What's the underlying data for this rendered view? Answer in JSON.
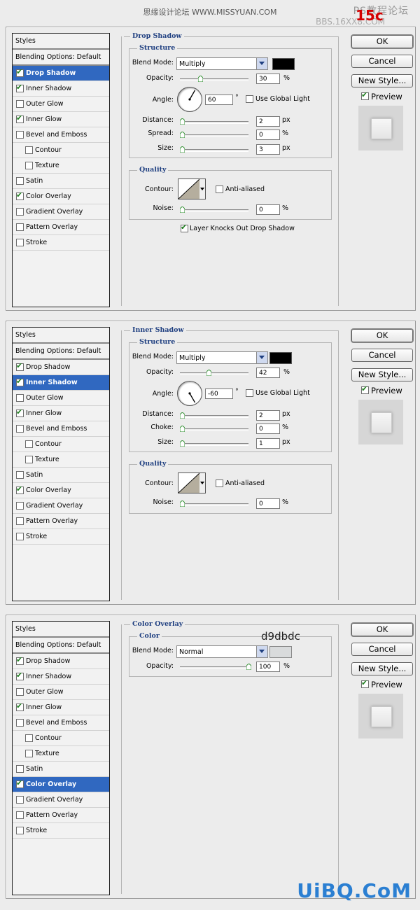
{
  "header": {
    "site_title": "思缘设计论坛 WWW.MISSYUAN.COM",
    "watermark_tr": "PS教程论坛",
    "watermark_tr2": "BBS.16XX8.COM",
    "watermark_num": "15c"
  },
  "styles_list": {
    "header": "Styles",
    "blending_options": "Blending Options: Default",
    "items": [
      "Drop Shadow",
      "Inner Shadow",
      "Outer Glow",
      "Inner Glow",
      "Bevel and Emboss",
      "Contour",
      "Texture",
      "Satin",
      "Color Overlay",
      "Gradient Overlay",
      "Pattern Overlay",
      "Stroke"
    ]
  },
  "buttons": {
    "ok": "OK",
    "cancel": "Cancel",
    "new_style": "New Style...",
    "preview": "Preview"
  },
  "panels": [
    {
      "section": "Drop Shadow",
      "group": "Structure",
      "blend_mode_label": "Blend Mode:",
      "blend_mode": "Multiply",
      "shadow_color": "#000000",
      "opacity_label": "Opacity:",
      "opacity": "30",
      "opacity_pct": 30,
      "angle_label": "Angle:",
      "angle": "60",
      "angle_deg": 60,
      "global_light": "Use Global Light",
      "distance_label": "Distance:",
      "distance": "2",
      "spread_label": "Spread:",
      "spread": "0",
      "size_label": "Size:",
      "size": "3",
      "quality": "Quality",
      "contour_label": "Contour:",
      "anti_aliased": "Anti-aliased",
      "noise_label": "Noise:",
      "noise": "0",
      "knocks_out": "Layer Knocks Out Drop Shadow",
      "px": "px",
      "pct": "%",
      "deg": "°"
    },
    {
      "section": "Inner Shadow",
      "group": "Structure",
      "blend_mode_label": "Blend Mode:",
      "blend_mode": "Multiply",
      "shadow_color": "#000000",
      "opacity_label": "Opacity:",
      "opacity": "42",
      "opacity_pct": 42,
      "angle_label": "Angle:",
      "angle": "-60",
      "angle_deg": -60,
      "global_light": "Use Global Light",
      "distance_label": "Distance:",
      "distance": "2",
      "choke_label": "Choke:",
      "choke": "0",
      "size_label": "Size:",
      "size": "1",
      "quality": "Quality",
      "contour_label": "Contour:",
      "anti_aliased": "Anti-aliased",
      "noise_label": "Noise:",
      "noise": "0",
      "px": "px",
      "pct": "%",
      "deg": "°"
    },
    {
      "section": "Color Overlay",
      "group": "Color",
      "blend_mode_label": "Blend Mode:",
      "blend_mode": "Normal",
      "overlay_color": "#d9dbdc",
      "color_note": "d9dbdc",
      "opacity_label": "Opacity:",
      "opacity": "100",
      "opacity_pct": 100,
      "pct": "%"
    }
  ],
  "footer": {
    "logo": "UiBQ.CoM"
  },
  "colors": {
    "accent": "#3068c0",
    "title_blue": "#1f3f80",
    "logo_blue": "#2b7fd2",
    "watermark_red": "#d40000"
  }
}
